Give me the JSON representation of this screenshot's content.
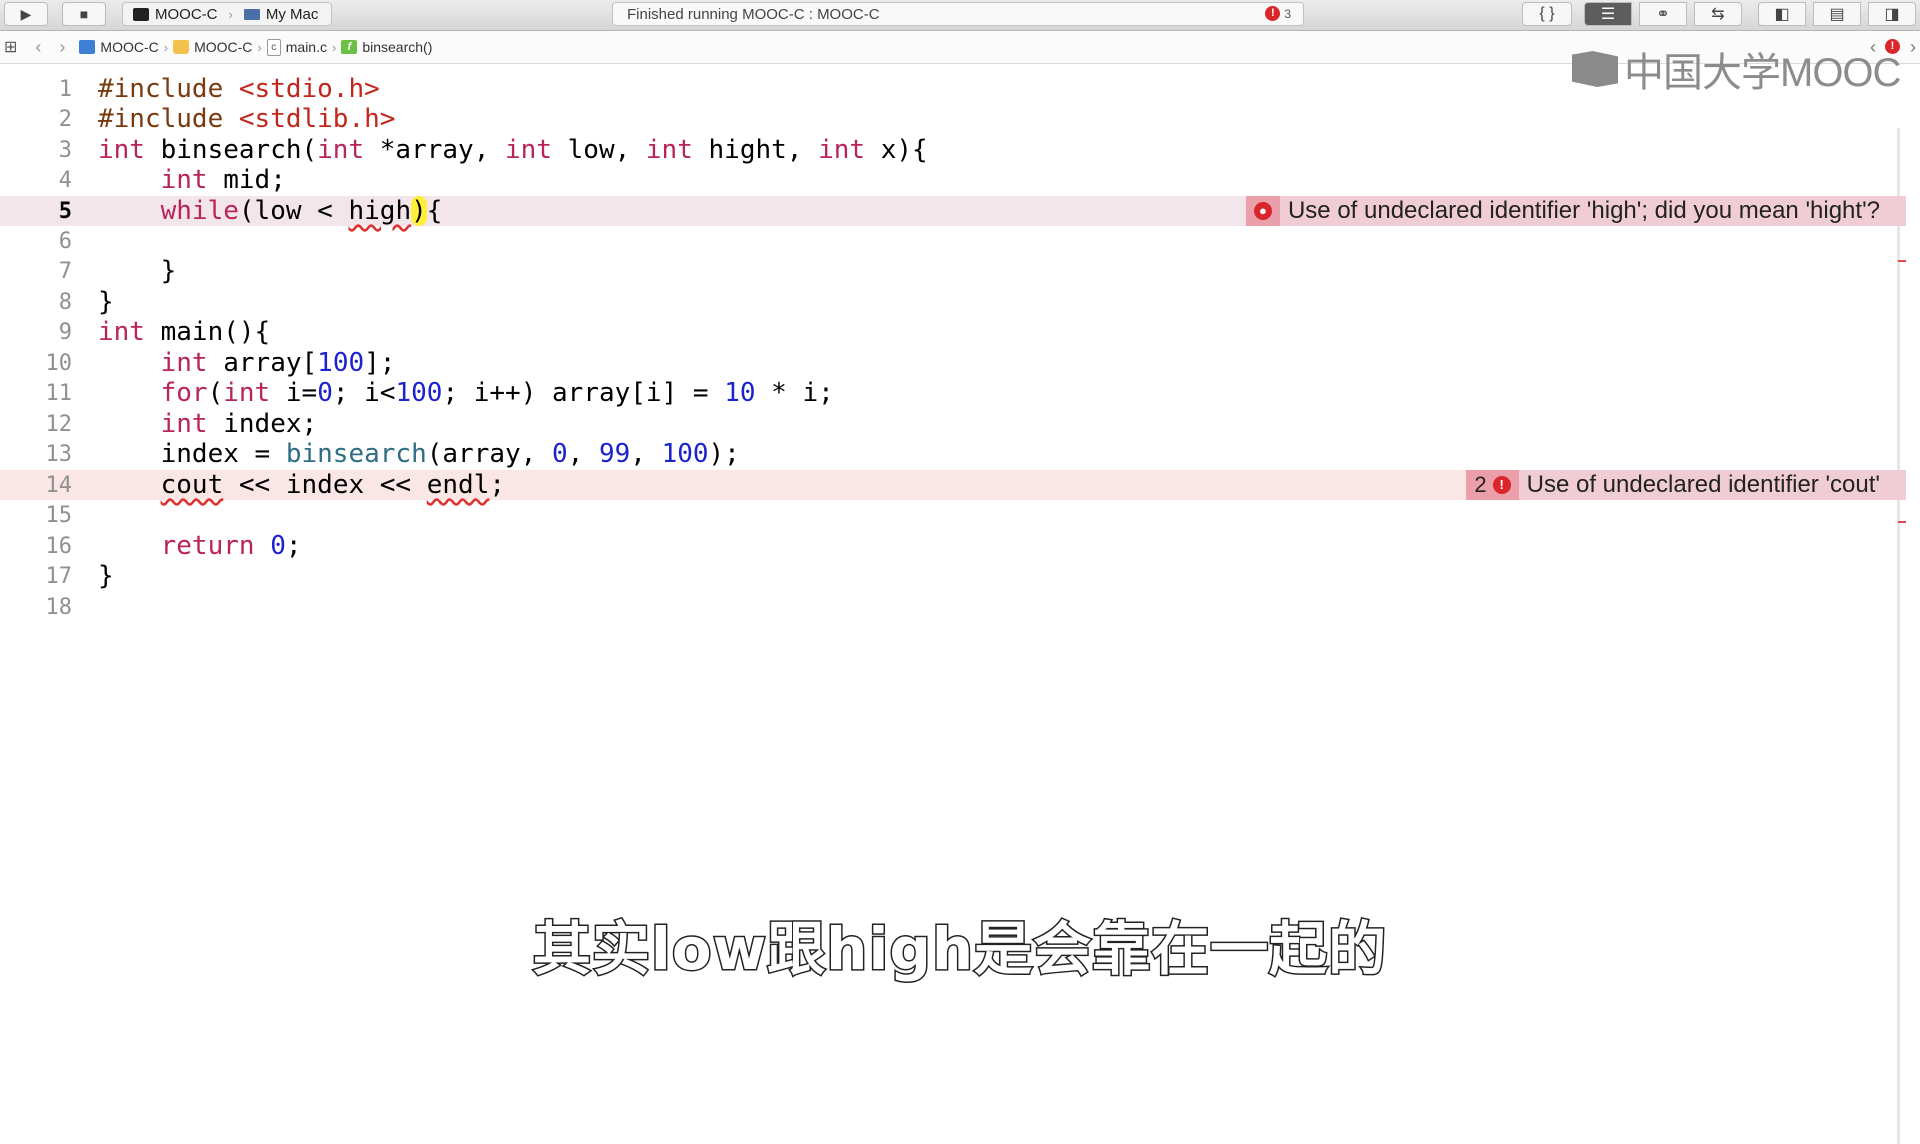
{
  "toolbar": {
    "run_icon": "play-icon",
    "stop_icon": "stop-icon",
    "scheme": "MOOC-C",
    "destination": "My Mac",
    "status": "Finished running MOOC-C : MOOC-C",
    "error_count": "3"
  },
  "jumpbar": {
    "items": [
      "MOOC-C",
      "MOOC-C",
      "main.c",
      "binsearch()"
    ]
  },
  "logo": {
    "text": "中国大学MOOC"
  },
  "editor": {
    "line_numbers": [
      "1",
      "2",
      "3",
      "4",
      "5",
      "6",
      "7",
      "8",
      "9",
      "10",
      "11",
      "12",
      "13",
      "14",
      "15",
      "16",
      "17",
      "18"
    ],
    "current_line": "5",
    "lines": {
      "l1": [
        "#include",
        " ",
        "<stdio.h>"
      ],
      "l2": [
        "#include",
        " ",
        "<stdlib.h>"
      ],
      "l3": [
        "int",
        " binsearch(",
        "int",
        " *array, ",
        "int",
        " low, ",
        "int",
        " hight, ",
        "int",
        " x){"
      ],
      "l4": [
        "    ",
        "int",
        " mid;"
      ],
      "l5": [
        "    ",
        "while",
        "(low < ",
        "high",
        ")",
        "{"
      ],
      "l6": [
        ""
      ],
      "l7": [
        "    }"
      ],
      "l8": [
        "}"
      ],
      "l9": [
        "int",
        " main(){"
      ],
      "l10": [
        "    ",
        "int",
        " array[",
        "100",
        "];"
      ],
      "l11": [
        "    ",
        "for",
        "(",
        "int",
        " i=",
        "0",
        "; i<",
        "100",
        "; i++) array[i] = ",
        "10",
        " * i;"
      ],
      "l12": [
        "    ",
        "int",
        " index;"
      ],
      "l13": [
        "    index = ",
        "binsearch",
        "(array, ",
        "0",
        ", ",
        "99",
        ", ",
        "100",
        ");"
      ],
      "l14": [
        "    ",
        "cout",
        " << index << ",
        "endl",
        ";"
      ],
      "l15": [
        ""
      ],
      "l16": [
        "    ",
        "return",
        " ",
        "0",
        ";"
      ],
      "l17": [
        "}"
      ],
      "l18": [
        ""
      ]
    },
    "errors": [
      {
        "line": "5",
        "message": "Use of undeclared identifier 'high'; did you mean 'hight'?"
      },
      {
        "line": "14",
        "count": "2",
        "message": "Use of undeclared identifier 'cout'"
      }
    ]
  },
  "subtitle": "其实low跟high是会靠在一起的",
  "colors": {
    "keyword": "#b8245b",
    "preprocessor": "#7a3a10",
    "string": "#c2271d",
    "number": "#1c22cc",
    "error_line": "#f3e6ea",
    "error_badge": "#ea9faa"
  }
}
